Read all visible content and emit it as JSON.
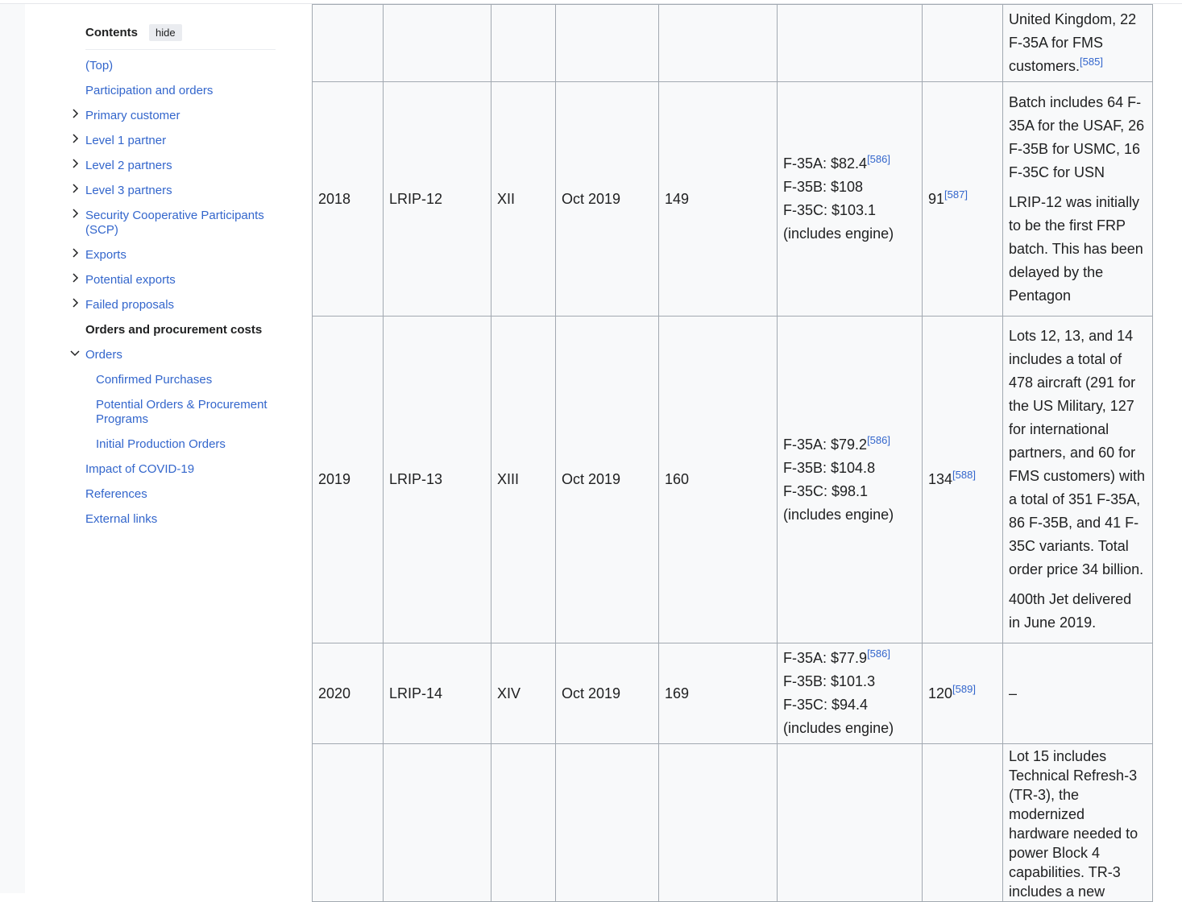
{
  "toc": {
    "title": "Contents",
    "hide_label": "hide",
    "items": [
      {
        "label": "(Top)"
      },
      {
        "label": "Participation and orders"
      },
      {
        "label": "Primary customer"
      },
      {
        "label": "Level 1 partner"
      },
      {
        "label": "Level 2 partners"
      },
      {
        "label": "Level 3 partners"
      },
      {
        "label": "Security Cooperative Participants (SCP)"
      },
      {
        "label": "Exports"
      },
      {
        "label": "Potential exports"
      },
      {
        "label": "Failed proposals"
      },
      {
        "label": "Orders and procurement costs"
      },
      {
        "label": "Orders"
      },
      {
        "label": "Confirmed Purchases"
      },
      {
        "label": "Potential Orders & Procurement Programs"
      },
      {
        "label": "Initial Production Orders"
      },
      {
        "label": "Impact of COVID-19"
      },
      {
        "label": "References"
      },
      {
        "label": "External links"
      }
    ]
  },
  "table": {
    "prev_row_notes": "United Kingdom, 22 F-35A for FMS customers.",
    "prev_row_ref": "[585]",
    "rows": [
      {
        "year": "2018",
        "lot": "LRIP-12",
        "block": "XII",
        "date": "Oct 2019",
        "qty": "149",
        "cost": [
          "F-35A: $82.4",
          "F-35B: $108",
          "F-35C: $103.1",
          "(includes engine)"
        ],
        "cost_ref": "[586]",
        "delivered": "91",
        "delivered_ref": "[587]",
        "notes": [
          "Batch includes 64 F-35A for the USAF, 26 F-35B for USMC, 16 F-35C for USN",
          "LRIP-12 was initially to be the first FRP batch. This has been delayed by the Pentagon"
        ]
      },
      {
        "year": "2019",
        "lot": "LRIP-13",
        "block": "XIII",
        "date": "Oct 2019",
        "qty": "160",
        "cost": [
          "F-35A: $79.2",
          "F-35B: $104.8",
          "F-35C: $98.1",
          "(includes engine)"
        ],
        "cost_ref": "[586]",
        "delivered": "134",
        "delivered_ref": "[588]",
        "notes": [
          "Lots 12, 13, and 14 includes a total of 478 aircraft (291 for the US Military, 127 for international partners, and 60 for FMS customers) with a total of 351 F-35A, 86 F-35B, and 41 F-35C variants. Total order price 34 billion.",
          "400th Jet delivered in June 2019."
        ]
      },
      {
        "year": "2020",
        "lot": "LRIP-14",
        "block": "XIV",
        "date": "Oct 2019",
        "qty": "169",
        "cost": [
          "F-35A: $77.9",
          "F-35B: $101.3",
          "F-35C: $94.4",
          "(includes engine)"
        ],
        "cost_ref": "[586]",
        "delivered": "120",
        "delivered_ref": "[589]",
        "notes": [
          "–"
        ]
      },
      {
        "year": "",
        "lot": "",
        "block": "",
        "date": "",
        "qty": "",
        "cost": [],
        "cost_ref": "",
        "delivered": "",
        "delivered_ref": "",
        "notes": [
          "Lot 15 includes Technical Refresh-3 (TR-3), the modernized hardware needed to power Block 4 capabilities. TR-3 includes a new"
        ]
      }
    ]
  }
}
